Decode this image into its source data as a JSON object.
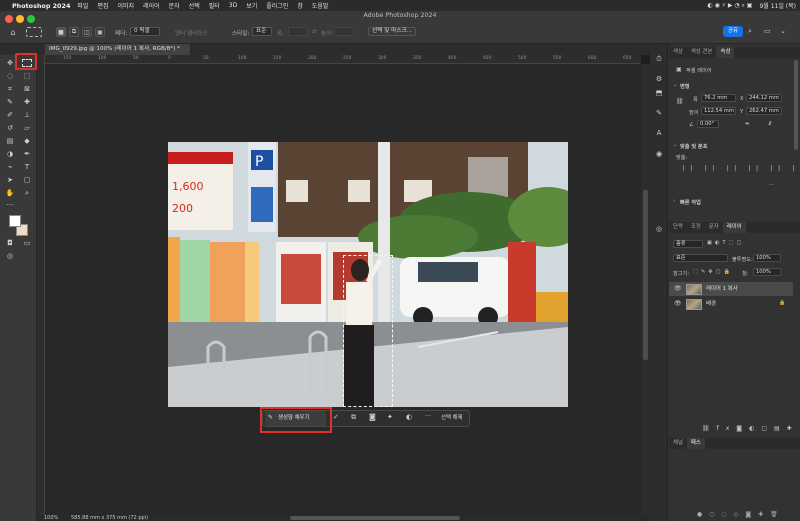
{
  "menubar": {
    "app_name": "Photoshop 2024",
    "menus": [
      "파일",
      "편집",
      "이미지",
      "레이어",
      "문자",
      "선택",
      "필터",
      "3D",
      "보기",
      "플러그인",
      "창",
      "도움말"
    ],
    "clock": "9월 11일 (목)"
  },
  "window": {
    "title": "Adobe Photoshop 2024"
  },
  "options_bar": {
    "feather_label": "페더:",
    "feather_value": "0 픽셀",
    "antialias_label": "앤티 앨리어스",
    "style_label": "스타일:",
    "style_value": "표준",
    "width_label": "폭:",
    "height_label": "높이:",
    "select_mask_label": "선택 및 마스크...",
    "share_label": "공유"
  },
  "document": {
    "tab_label": "IMG_0929.jpg @ 100% (레이어 1 복사, RGB/8*) *",
    "ruler_ticks": [
      "150",
      "100",
      "50",
      "0",
      "50",
      "100",
      "150",
      "200",
      "250",
      "300",
      "350",
      "400",
      "450",
      "500",
      "550",
      "600",
      "650"
    ]
  },
  "contextual_bar": {
    "generative_fill_label": "생성형 채우기",
    "deselect_label": "선택 해제",
    "more_label": "···"
  },
  "status_bar": {
    "zoom": "100%",
    "doc_info": "585.88 mm x 375 mm (72 ppi)"
  },
  "properties_panel": {
    "tabs": [
      "색상",
      "색상 견본",
      "속성"
    ],
    "active_tab": "속성",
    "layer_type": "픽셀 레이어",
    "transform_header": "변형",
    "w_label": "폭",
    "w_value": "76.2 mm",
    "x_label": "X",
    "x_value": "244.12 mm",
    "h_label": "높이",
    "h_value": "112.54 mm",
    "y_label": "Y",
    "y_value": "262.47 mm",
    "angle_value": "0.00°",
    "align_header": "맞춤 및 분포",
    "align_label": "맞춤:",
    "quick_actions_header": "빠른 작업",
    "more_label": "···"
  },
  "layers_panel": {
    "tabs": [
      "단락",
      "조정",
      "문자",
      "레이어"
    ],
    "active_tab": "레이어",
    "filter_label": "종류",
    "blend_mode": "표준",
    "opacity_label": "불투명도:",
    "opacity_value": "100%",
    "lock_label": "잠그기:",
    "fill_label": "칠:",
    "fill_value": "100%",
    "layers": [
      {
        "name": "레이어 1 복사",
        "selected": true
      },
      {
        "name": "배경",
        "selected": false
      }
    ]
  },
  "bottom_panel": {
    "tabs": [
      "채널",
      "패스"
    ],
    "active_tab": "패스"
  },
  "colors": {
    "accent_blue": "#1473e6",
    "highlight_red": "#e0302a",
    "foreground_swatch": "#ffffff",
    "background_swatch": "#f0dcc2"
  }
}
